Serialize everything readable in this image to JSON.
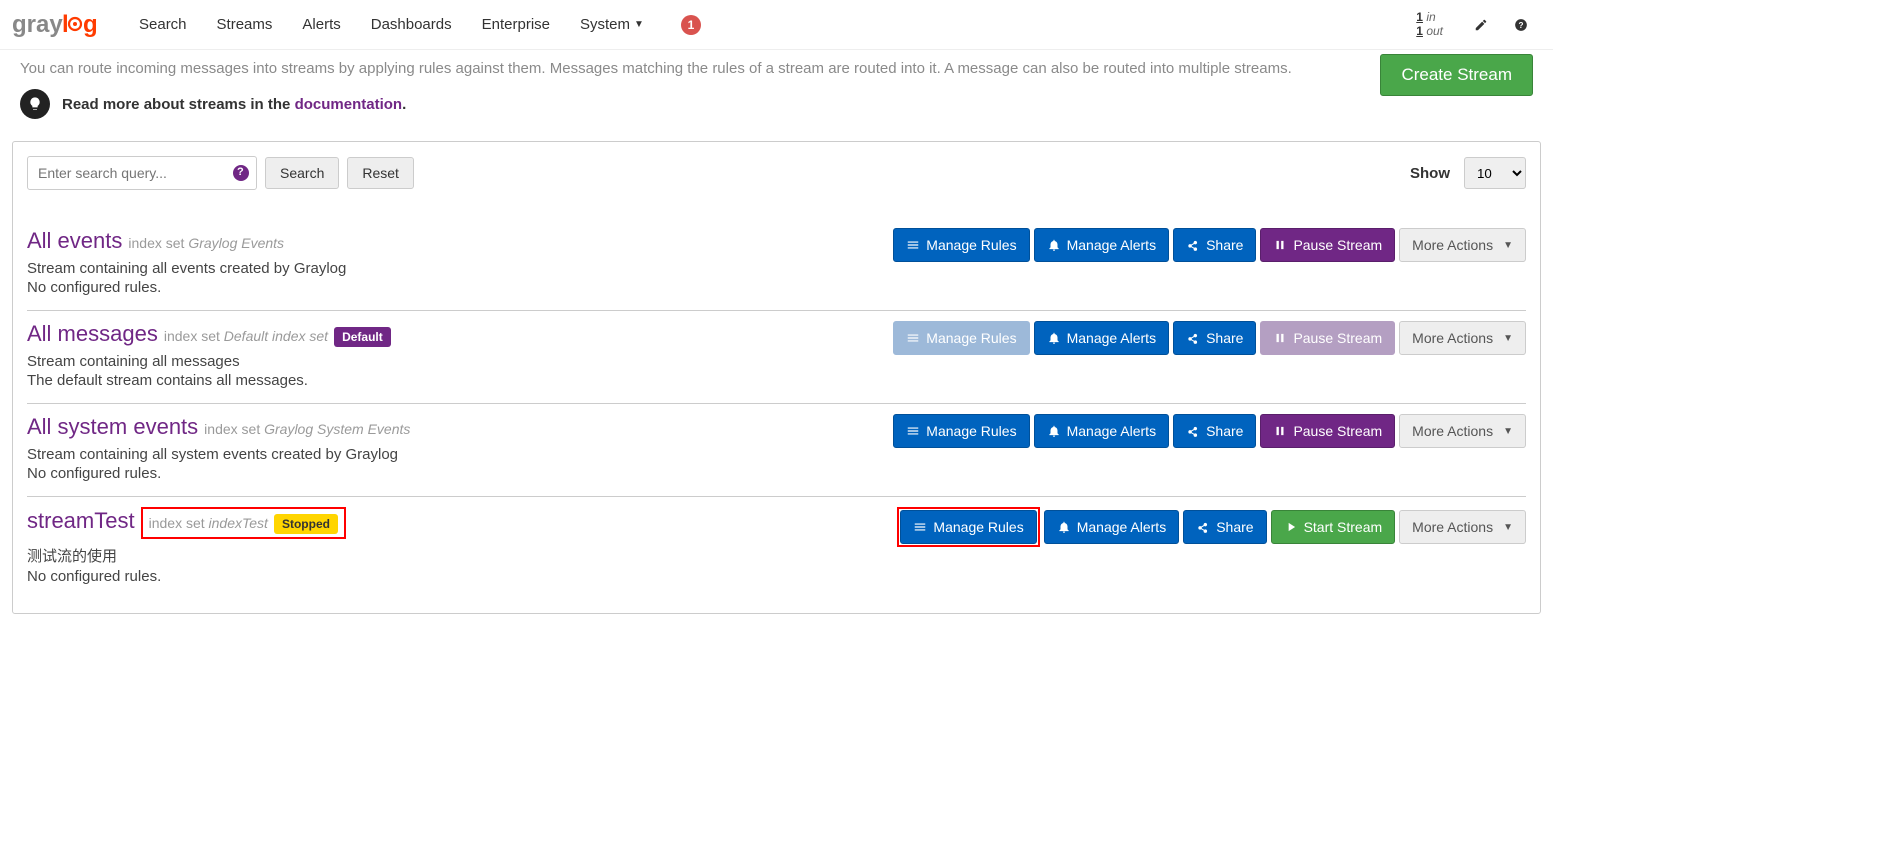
{
  "nav": {
    "items": [
      "Search",
      "Streams",
      "Alerts",
      "Dashboards",
      "Enterprise",
      "System"
    ],
    "notif_count": "1",
    "throughput_in_num": "1",
    "throughput_in_lbl": "in",
    "throughput_out_num": "1",
    "throughput_out_lbl": "out"
  },
  "header": {
    "desc": "You can route incoming messages into streams by applying rules against them. Messages matching the rules of a stream are routed into it. A message can also be routed into multiple streams.",
    "callout_prefix": "Read more about streams in the ",
    "callout_link": "documentation",
    "callout_suffix": ".",
    "create_btn": "Create Stream"
  },
  "toolbar": {
    "search_placeholder": "Enter search query...",
    "search_btn": "Search",
    "reset_btn": "Reset",
    "show_label": "Show",
    "page_size": "10"
  },
  "labels": {
    "index_set_prefix": "index set",
    "default_badge": "Default",
    "stopped_badge": "Stopped",
    "manage_rules": "Manage Rules",
    "manage_alerts": "Manage Alerts",
    "share": "Share",
    "pause_stream": "Pause Stream",
    "start_stream": "Start Stream",
    "more_actions": "More Actions"
  },
  "streams": [
    {
      "title": "All events",
      "index_set": "Graylog Events",
      "desc": "Stream containing all events created by Graylog",
      "rules": "No configured rules.",
      "default": false,
      "stopped": false,
      "rules_disabled": false,
      "pause_disabled": false,
      "start": false,
      "highlight_rules": false,
      "highlight_badges": false
    },
    {
      "title": "All messages",
      "index_set": "Default index set",
      "desc": "Stream containing all messages",
      "rules": "The default stream contains all messages.",
      "default": true,
      "stopped": false,
      "rules_disabled": true,
      "pause_disabled": true,
      "start": false,
      "highlight_rules": false,
      "highlight_badges": false
    },
    {
      "title": "All system events",
      "index_set": "Graylog System Events",
      "desc": "Stream containing all system events created by Graylog",
      "rules": "No configured rules.",
      "default": false,
      "stopped": false,
      "rules_disabled": false,
      "pause_disabled": false,
      "start": false,
      "highlight_rules": false,
      "highlight_badges": false
    },
    {
      "title": "streamTest",
      "index_set": "indexTest",
      "desc": "测试流的使用",
      "rules": "No configured rules.",
      "default": false,
      "stopped": true,
      "rules_disabled": false,
      "pause_disabled": false,
      "start": true,
      "highlight_rules": true,
      "highlight_badges": true
    }
  ]
}
